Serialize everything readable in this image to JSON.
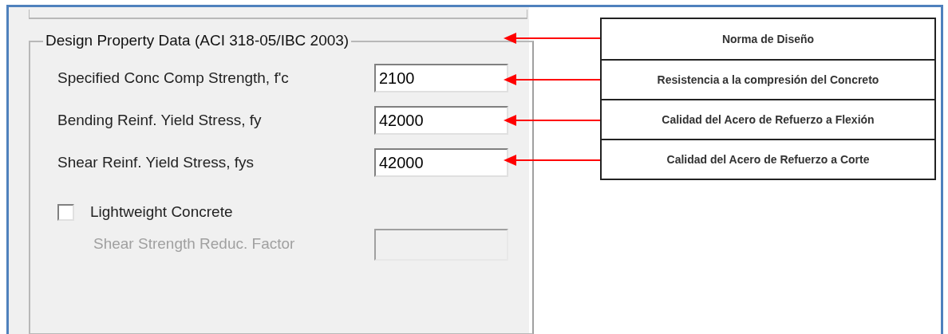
{
  "group": {
    "title": "Design Property Data (ACI 318-05/IBC 2003)"
  },
  "fields": [
    {
      "label": "Specified Conc Comp Strength, f'c",
      "value": "2100"
    },
    {
      "label": "Bending Reinf. Yield Stress, fy",
      "value": "42000"
    },
    {
      "label": "Shear Reinf. Yield Stress, fys",
      "value": "42000"
    }
  ],
  "checkbox": {
    "label": "Lightweight Concrete",
    "checked": false
  },
  "reduction_field": {
    "label": "Shear Strength Reduc. Factor",
    "disabled": true
  },
  "annotations": [
    {
      "text": "Norma de Diseño"
    },
    {
      "text": "Resistencia a la compresión del Concreto"
    },
    {
      "text": "Calidad del Acero de Refuerzo a Flexión"
    },
    {
      "text": "Calidad del Acero de Refuerzo a Corte"
    }
  ]
}
